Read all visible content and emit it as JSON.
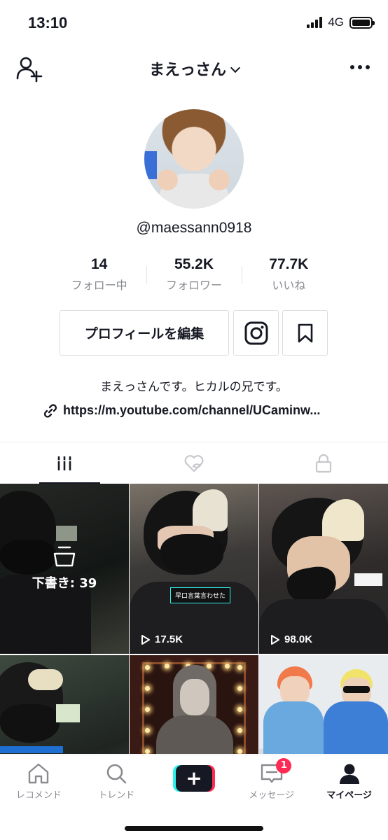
{
  "status_bar": {
    "time": "13:10",
    "network": "4G"
  },
  "header": {
    "title": "まえっさん"
  },
  "profile": {
    "username": "@maessann0918",
    "stats": [
      {
        "value": "14",
        "label": "フォロー中"
      },
      {
        "value": "55.2K",
        "label": "フォロワー"
      },
      {
        "value": "77.7K",
        "label": "いいね"
      }
    ],
    "edit_button": "プロフィールを編集",
    "bio": "まえっさんです。ヒカルの兄です。",
    "link": "https://m.youtube.com/channel/UCaminw..."
  },
  "videos": {
    "draft_label": "下書き: 39",
    "items": [
      {
        "views": "17.5K",
        "caption": "早口言葉言わせた"
      },
      {
        "views": "98.0K"
      }
    ]
  },
  "nav": {
    "items": [
      {
        "label": "レコメンド"
      },
      {
        "label": "トレンド"
      },
      {
        "label": "メッセージ",
        "badge": "1"
      },
      {
        "label": "マイページ"
      }
    ]
  },
  "colors": {
    "accent": "#fe2c55",
    "cyan": "#25f4ee",
    "text": "#161823"
  }
}
